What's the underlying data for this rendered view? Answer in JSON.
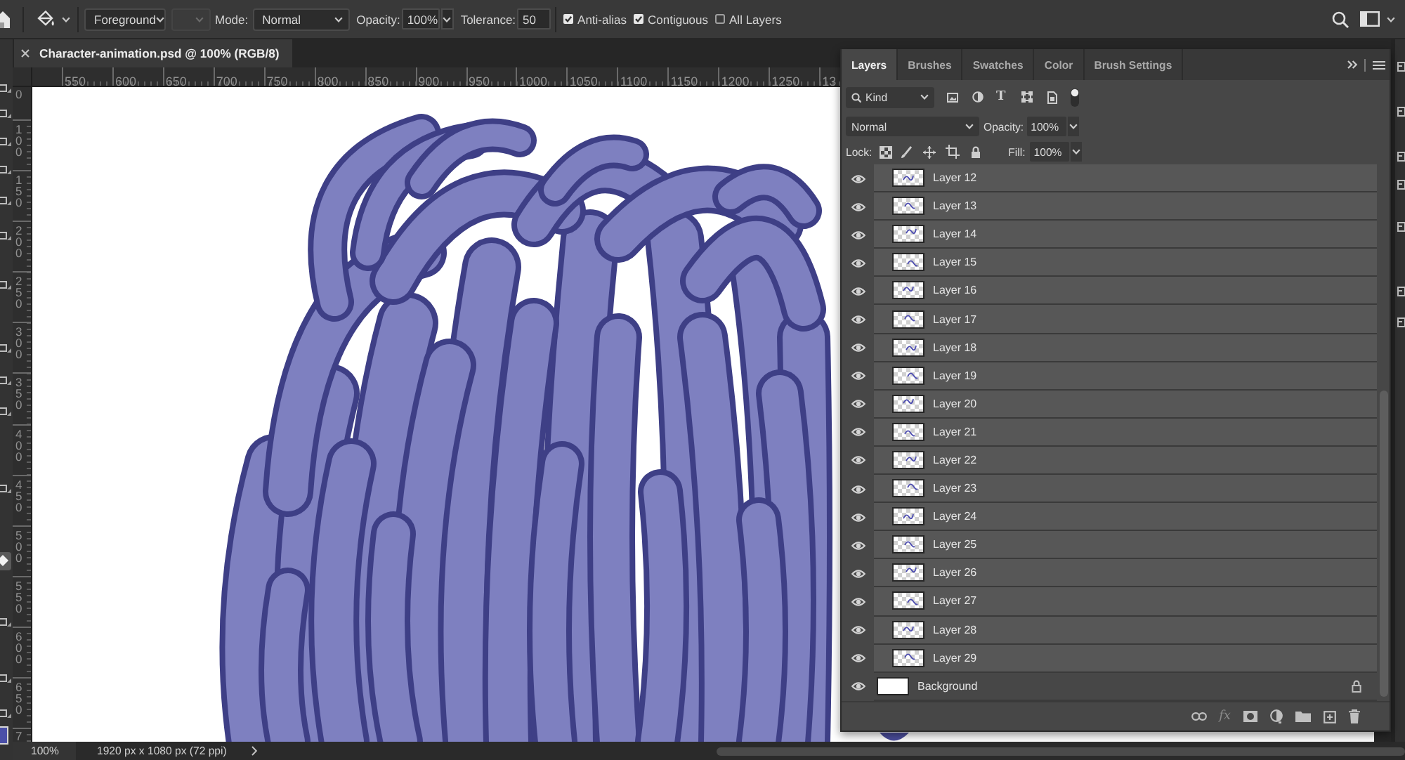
{
  "options_bar": {
    "fill_source": "Foreground",
    "pattern_picker": {
      "disabled": true
    },
    "mode_label": "Mode:",
    "mode": "Normal",
    "opacity_label": "Opacity:",
    "opacity": "100%",
    "tolerance_label": "Tolerance:",
    "tolerance": "50",
    "checkboxes": [
      {
        "label": "Anti-alias",
        "checked": true
      },
      {
        "label": "Contiguous",
        "checked": true
      },
      {
        "label": "All Layers",
        "checked": false
      }
    ]
  },
  "document_tab": {
    "title": "Character-animation.psd @ 100% (RGB/8)"
  },
  "rulers": {
    "horizontal": [
      "550",
      "600",
      "650",
      "700",
      "750",
      "800",
      "850",
      "900",
      "950",
      "1000",
      "1050",
      "1100",
      "1150",
      "1200",
      "1250",
      "13"
    ],
    "vertical": [
      "0",
      "100",
      "150",
      "200",
      "250",
      "300",
      "350",
      "400",
      "450",
      "500",
      "550",
      "600",
      "650",
      "7"
    ]
  },
  "layers_panel": {
    "tabs": [
      {
        "label": "Layers",
        "selected": true
      },
      {
        "label": "Brushes",
        "selected": false
      },
      {
        "label": "Swatches",
        "selected": false
      },
      {
        "label": "Color",
        "selected": false
      },
      {
        "label": "Brush Settings",
        "selected": false
      }
    ],
    "filter_kind": "Kind",
    "type_filter": "T",
    "filter_on": true,
    "blend_mode": "Normal",
    "opacity_label": "Opacity:",
    "opacity": "100%",
    "lock_label": "Lock:",
    "fill_label": "Fill:",
    "fill": "100%",
    "layers": [
      {
        "kind": "layer",
        "name": "Layer 12",
        "visible": true,
        "selected": true
      },
      {
        "kind": "layer",
        "name": "Layer 13",
        "visible": true,
        "selected": true
      },
      {
        "kind": "layer",
        "name": "Layer 14",
        "visible": true,
        "selected": true
      },
      {
        "kind": "layer",
        "name": "Layer 15",
        "visible": true,
        "selected": true
      },
      {
        "kind": "layer",
        "name": "Layer 16",
        "visible": true,
        "selected": true
      },
      {
        "kind": "layer",
        "name": "Layer 17",
        "visible": true,
        "selected": true
      },
      {
        "kind": "layer",
        "name": "Layer 18",
        "visible": true,
        "selected": true
      },
      {
        "kind": "layer",
        "name": "Layer 19",
        "visible": true,
        "selected": true
      },
      {
        "kind": "layer",
        "name": "Layer 20",
        "visible": true,
        "selected": true
      },
      {
        "kind": "layer",
        "name": "Layer 21",
        "visible": true,
        "selected": true
      },
      {
        "kind": "layer",
        "name": "Layer 22",
        "visible": true,
        "selected": true
      },
      {
        "kind": "layer",
        "name": "Layer 23",
        "visible": true,
        "selected": true
      },
      {
        "kind": "layer",
        "name": "Layer 24",
        "visible": true,
        "selected": true
      },
      {
        "kind": "layer",
        "name": "Layer 25",
        "visible": true,
        "selected": true
      },
      {
        "kind": "layer",
        "name": "Layer 26",
        "visible": true,
        "selected": true
      },
      {
        "kind": "layer",
        "name": "Layer 27",
        "visible": true,
        "selected": true
      },
      {
        "kind": "layer",
        "name": "Layer 28",
        "visible": true,
        "selected": true
      },
      {
        "kind": "layer",
        "name": "Layer 29",
        "visible": true,
        "selected": true
      },
      {
        "kind": "background",
        "name": "Background",
        "visible": true,
        "selected": false,
        "locked": true
      }
    ],
    "effects": "fx"
  },
  "status_bar": {
    "zoom": "100%",
    "document_size": "1920 px x 1080 px (72 ppi)"
  }
}
